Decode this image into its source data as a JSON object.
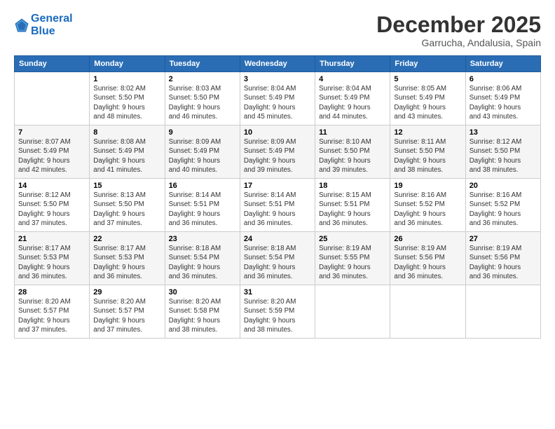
{
  "header": {
    "logo_line1": "General",
    "logo_line2": "Blue",
    "month": "December 2025",
    "location": "Garrucha, Andalusia, Spain"
  },
  "weekdays": [
    "Sunday",
    "Monday",
    "Tuesday",
    "Wednesday",
    "Thursday",
    "Friday",
    "Saturday"
  ],
  "weeks": [
    [
      {
        "day": "",
        "info": ""
      },
      {
        "day": "1",
        "info": "Sunrise: 8:02 AM\nSunset: 5:50 PM\nDaylight: 9 hours\nand 48 minutes."
      },
      {
        "day": "2",
        "info": "Sunrise: 8:03 AM\nSunset: 5:50 PM\nDaylight: 9 hours\nand 46 minutes."
      },
      {
        "day": "3",
        "info": "Sunrise: 8:04 AM\nSunset: 5:49 PM\nDaylight: 9 hours\nand 45 minutes."
      },
      {
        "day": "4",
        "info": "Sunrise: 8:04 AM\nSunset: 5:49 PM\nDaylight: 9 hours\nand 44 minutes."
      },
      {
        "day": "5",
        "info": "Sunrise: 8:05 AM\nSunset: 5:49 PM\nDaylight: 9 hours\nand 43 minutes."
      },
      {
        "day": "6",
        "info": "Sunrise: 8:06 AM\nSunset: 5:49 PM\nDaylight: 9 hours\nand 43 minutes."
      }
    ],
    [
      {
        "day": "7",
        "info": "Sunrise: 8:07 AM\nSunset: 5:49 PM\nDaylight: 9 hours\nand 42 minutes."
      },
      {
        "day": "8",
        "info": "Sunrise: 8:08 AM\nSunset: 5:49 PM\nDaylight: 9 hours\nand 41 minutes."
      },
      {
        "day": "9",
        "info": "Sunrise: 8:09 AM\nSunset: 5:49 PM\nDaylight: 9 hours\nand 40 minutes."
      },
      {
        "day": "10",
        "info": "Sunrise: 8:09 AM\nSunset: 5:49 PM\nDaylight: 9 hours\nand 39 minutes."
      },
      {
        "day": "11",
        "info": "Sunrise: 8:10 AM\nSunset: 5:50 PM\nDaylight: 9 hours\nand 39 minutes."
      },
      {
        "day": "12",
        "info": "Sunrise: 8:11 AM\nSunset: 5:50 PM\nDaylight: 9 hours\nand 38 minutes."
      },
      {
        "day": "13",
        "info": "Sunrise: 8:12 AM\nSunset: 5:50 PM\nDaylight: 9 hours\nand 38 minutes."
      }
    ],
    [
      {
        "day": "14",
        "info": "Sunrise: 8:12 AM\nSunset: 5:50 PM\nDaylight: 9 hours\nand 37 minutes."
      },
      {
        "day": "15",
        "info": "Sunrise: 8:13 AM\nSunset: 5:50 PM\nDaylight: 9 hours\nand 37 minutes."
      },
      {
        "day": "16",
        "info": "Sunrise: 8:14 AM\nSunset: 5:51 PM\nDaylight: 9 hours\nand 36 minutes."
      },
      {
        "day": "17",
        "info": "Sunrise: 8:14 AM\nSunset: 5:51 PM\nDaylight: 9 hours\nand 36 minutes."
      },
      {
        "day": "18",
        "info": "Sunrise: 8:15 AM\nSunset: 5:51 PM\nDaylight: 9 hours\nand 36 minutes."
      },
      {
        "day": "19",
        "info": "Sunrise: 8:16 AM\nSunset: 5:52 PM\nDaylight: 9 hours\nand 36 minutes."
      },
      {
        "day": "20",
        "info": "Sunrise: 8:16 AM\nSunset: 5:52 PM\nDaylight: 9 hours\nand 36 minutes."
      }
    ],
    [
      {
        "day": "21",
        "info": "Sunrise: 8:17 AM\nSunset: 5:53 PM\nDaylight: 9 hours\nand 36 minutes."
      },
      {
        "day": "22",
        "info": "Sunrise: 8:17 AM\nSunset: 5:53 PM\nDaylight: 9 hours\nand 36 minutes."
      },
      {
        "day": "23",
        "info": "Sunrise: 8:18 AM\nSunset: 5:54 PM\nDaylight: 9 hours\nand 36 minutes."
      },
      {
        "day": "24",
        "info": "Sunrise: 8:18 AM\nSunset: 5:54 PM\nDaylight: 9 hours\nand 36 minutes."
      },
      {
        "day": "25",
        "info": "Sunrise: 8:19 AM\nSunset: 5:55 PM\nDaylight: 9 hours\nand 36 minutes."
      },
      {
        "day": "26",
        "info": "Sunrise: 8:19 AM\nSunset: 5:56 PM\nDaylight: 9 hours\nand 36 minutes."
      },
      {
        "day": "27",
        "info": "Sunrise: 8:19 AM\nSunset: 5:56 PM\nDaylight: 9 hours\nand 36 minutes."
      }
    ],
    [
      {
        "day": "28",
        "info": "Sunrise: 8:20 AM\nSunset: 5:57 PM\nDaylight: 9 hours\nand 37 minutes."
      },
      {
        "day": "29",
        "info": "Sunrise: 8:20 AM\nSunset: 5:57 PM\nDaylight: 9 hours\nand 37 minutes."
      },
      {
        "day": "30",
        "info": "Sunrise: 8:20 AM\nSunset: 5:58 PM\nDaylight: 9 hours\nand 38 minutes."
      },
      {
        "day": "31",
        "info": "Sunrise: 8:20 AM\nSunset: 5:59 PM\nDaylight: 9 hours\nand 38 minutes."
      },
      {
        "day": "",
        "info": ""
      },
      {
        "day": "",
        "info": ""
      },
      {
        "day": "",
        "info": ""
      }
    ]
  ]
}
